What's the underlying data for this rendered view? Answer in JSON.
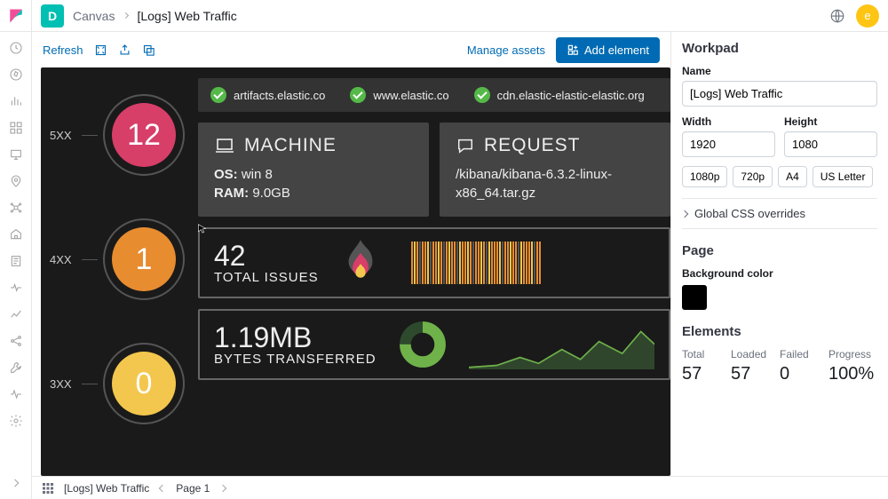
{
  "header": {
    "app_letter": "D",
    "crumb1": "Canvas",
    "crumb2": "[Logs] Web Traffic",
    "avatar_letter": "e"
  },
  "toolbar": {
    "refresh": "Refresh",
    "manage_assets": "Manage assets",
    "add_element": "Add element"
  },
  "canvas": {
    "status": {
      "s5xx": {
        "label": "5XX",
        "value": "12"
      },
      "s4xx": {
        "label": "4XX",
        "value": "1"
      },
      "s3xx": {
        "label": "3XX",
        "value": "0"
      }
    },
    "hosts": [
      "artifacts.elastic.co",
      "www.elastic.co",
      "cdn.elastic-elastic-elastic.org"
    ],
    "machine": {
      "title": "MACHINE",
      "os_label": "OS:",
      "os_value": "win 8",
      "ram_label": "RAM:",
      "ram_value": "9.0GB"
    },
    "request": {
      "title": "REQUEST",
      "path": "/kibana/kibana-6.3.2-linux-x86_64.tar.gz"
    },
    "issues": {
      "value": "42",
      "label": "TOTAL ISSUES"
    },
    "bytes": {
      "value": "1.19MB",
      "label": "BYTES TRANSFERRED"
    }
  },
  "panel": {
    "workpad_hdr": "Workpad",
    "name_lbl": "Name",
    "name_val": "[Logs] Web Traffic",
    "width_lbl": "Width",
    "width_val": "1920",
    "height_lbl": "Height",
    "height_val": "1080",
    "presets": [
      "1080p",
      "720p",
      "A4",
      "US Letter"
    ],
    "css_overrides": "Global CSS overrides",
    "page_hdr": "Page",
    "bg_lbl": "Background color",
    "elements_hdr": "Elements",
    "stats": {
      "total": {
        "lbl": "Total",
        "val": "57"
      },
      "loaded": {
        "lbl": "Loaded",
        "val": "57"
      },
      "failed": {
        "lbl": "Failed",
        "val": "0"
      },
      "progress": {
        "lbl": "Progress",
        "val": "100%"
      }
    }
  },
  "footer": {
    "workpad": "[Logs] Web Traffic",
    "page": "Page 1"
  },
  "colors": {
    "primary": "#006bb4",
    "c5xx": "#d73e68",
    "c4xx": "#e88c30",
    "c3xx": "#f3c74d",
    "success": "#54b948"
  }
}
